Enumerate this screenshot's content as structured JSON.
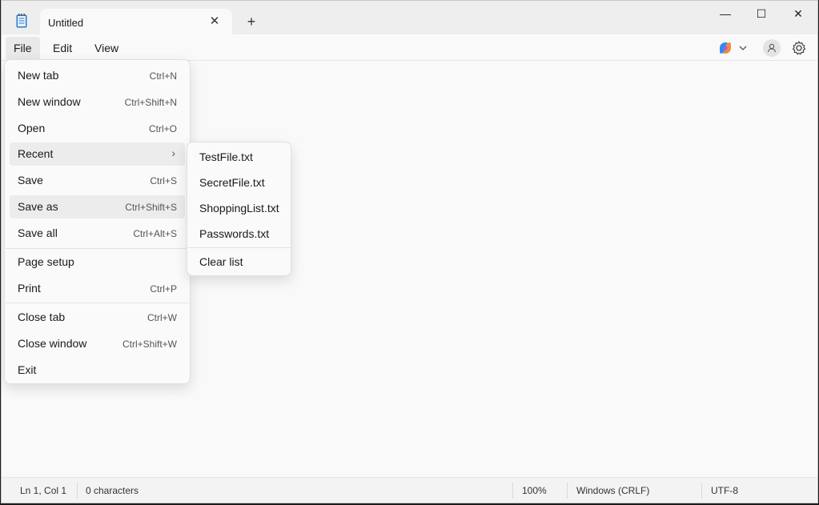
{
  "tab": {
    "title": "Untitled",
    "close": "✕",
    "new_tab": "+"
  },
  "window_controls": {
    "minimize": "—",
    "maximize": "☐",
    "close": "✕"
  },
  "menubar": {
    "file": "File",
    "edit": "Edit",
    "view": "View"
  },
  "file_menu": {
    "items": [
      {
        "label": "New tab",
        "shortcut": "Ctrl+N"
      },
      {
        "label": "New window",
        "shortcut": "Ctrl+Shift+N"
      },
      {
        "label": "Open",
        "shortcut": "Ctrl+O"
      },
      {
        "label": "Recent",
        "shortcut": ""
      },
      {
        "label": "Save",
        "shortcut": "Ctrl+S"
      },
      {
        "label": "Save as",
        "shortcut": "Ctrl+Shift+S"
      },
      {
        "label": "Save all",
        "shortcut": "Ctrl+Alt+S"
      },
      {
        "label": "Page setup",
        "shortcut": ""
      },
      {
        "label": "Print",
        "shortcut": "Ctrl+P"
      },
      {
        "label": "Close tab",
        "shortcut": "Ctrl+W"
      },
      {
        "label": "Close window",
        "shortcut": "Ctrl+Shift+W"
      },
      {
        "label": "Exit",
        "shortcut": ""
      }
    ]
  },
  "recent_menu": {
    "files": [
      "TestFile.txt",
      "SecretFile.txt",
      "ShoppingList.txt",
      "Passwords.txt"
    ],
    "clear": "Clear list"
  },
  "statusbar": {
    "position": "Ln 1, Col 1",
    "characters": "0 characters",
    "zoom": "100%",
    "line_ending": "Windows (CRLF)",
    "encoding": "UTF-8"
  },
  "colors": {
    "accent": "#0067c0",
    "menu_hover": "#ececec"
  }
}
